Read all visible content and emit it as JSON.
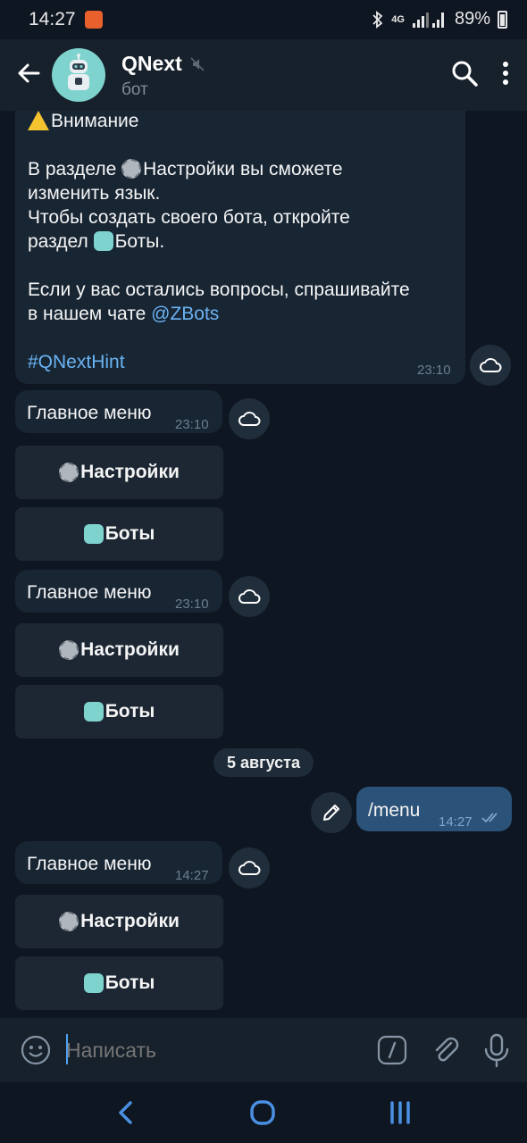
{
  "status": {
    "time": "14:27",
    "network": "4G",
    "battery": "89%"
  },
  "header": {
    "title": "QNext",
    "subtitle": "бот"
  },
  "messages": {
    "info": {
      "warning": "Внимание",
      "line1": "В разделе ",
      "settings_ref": "Настройки",
      "line1b": " вы сможете",
      "line2": "изменить язык.",
      "line3": "Чтобы создать своего бота, откройте",
      "line4a": "раздел ",
      "bots_ref": "Боты",
      "line4b": ".",
      "line5": "Если у вас остались вопросы, спрашивайте",
      "line6a": "в нашем чате ",
      "link": "@ZBots",
      "hashtag": "#QNextHint",
      "time": "23:10"
    },
    "menu1": {
      "text": "Главное меню",
      "time": "23:10",
      "buttons": [
        "Настройки",
        "Боты"
      ]
    },
    "menu2": {
      "text": "Главное меню",
      "time": "23:10",
      "buttons": [
        "Настройки",
        "Боты"
      ]
    },
    "date_separator": "5 августа",
    "outgoing": {
      "text": "/menu",
      "time": "14:27"
    },
    "menu3": {
      "text": "Главное меню",
      "time": "14:27",
      "buttons": [
        "Настройки",
        "Боты"
      ]
    }
  },
  "input": {
    "placeholder": "Написать"
  },
  "colors": {
    "background": "#0e1621",
    "header": "#17212b",
    "incoming": "#182533",
    "outgoing": "#2b5278",
    "link": "#6ab3f3"
  }
}
